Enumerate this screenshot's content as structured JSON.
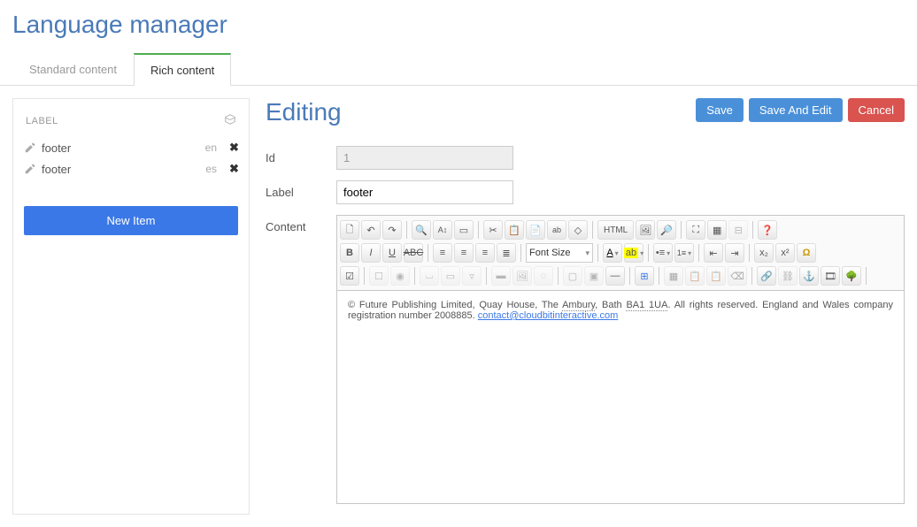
{
  "page": {
    "title": "Language manager",
    "editing_title": "Editing"
  },
  "tabs": {
    "standard": "Standard content",
    "rich": "Rich content",
    "active": "rich"
  },
  "sidebar": {
    "header": "LABEL",
    "items": [
      {
        "name": "footer",
        "lang": "en"
      },
      {
        "name": "footer",
        "lang": "es"
      }
    ],
    "new_button": "New Item"
  },
  "actions": {
    "save": "Save",
    "save_edit": "Save And Edit",
    "cancel": "Cancel"
  },
  "form": {
    "id_label": "Id",
    "id_value": "1",
    "label_label": "Label",
    "label_value": "footer",
    "content_label": "Content"
  },
  "editor": {
    "font_size_placeholder": "Font Size",
    "html_btn": "HTML",
    "content_prefix": "© Future Publishing Limited, Quay House, The ",
    "content_dotted1": "Ambury",
    "content_mid": ", Bath ",
    "content_dotted2": "BA1 1UA",
    "content_after": ". All rights reserved. England and Wales company registration number 2008885. ",
    "content_email": "contact@cloudbitinteractive.com"
  },
  "colors": {
    "accent": "#4a7ab8",
    "primary_btn": "#3b78e7",
    "danger": "#d9534f",
    "tab_active": "#4caf50"
  }
}
